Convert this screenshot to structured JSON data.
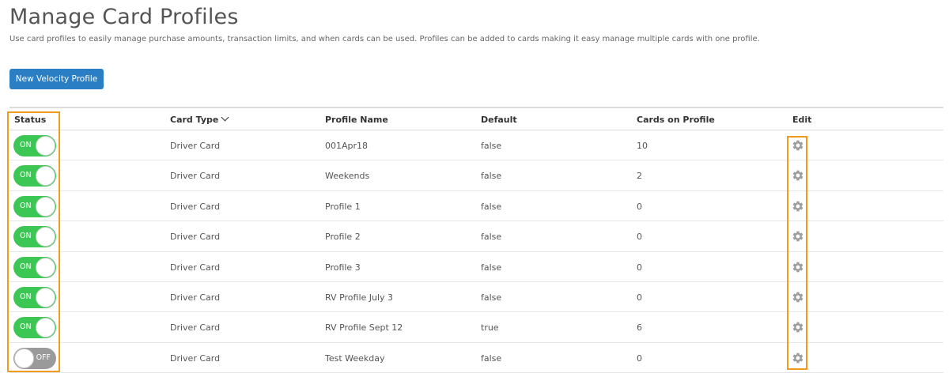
{
  "header": {
    "title": "Manage Card Profiles",
    "description": "Use card profiles to easily manage purchase amounts, transaction limits, and when cards can be used. Profiles can be added to cards making it easy manage multiple cards with one profile."
  },
  "actions": {
    "new_profile_label": "New Velocity Profile"
  },
  "table": {
    "columns": {
      "status": "Status",
      "card_type": "Card Type",
      "profile_name": "Profile Name",
      "default": "Default",
      "cards_on_profile": "Cards on Profile",
      "edit": "Edit"
    },
    "rows": [
      {
        "status": "ON",
        "card_type": "Driver Card",
        "profile_name": "001Apr18",
        "default": "false",
        "cards_on_profile": "10"
      },
      {
        "status": "ON",
        "card_type": "Driver Card",
        "profile_name": "Weekends",
        "default": "false",
        "cards_on_profile": "2"
      },
      {
        "status": "ON",
        "card_type": "Driver Card",
        "profile_name": "Profile 1",
        "default": "false",
        "cards_on_profile": "0"
      },
      {
        "status": "ON",
        "card_type": "Driver Card",
        "profile_name": "Profile 2",
        "default": "false",
        "cards_on_profile": "0"
      },
      {
        "status": "ON",
        "card_type": "Driver Card",
        "profile_name": "Profile 3",
        "default": "false",
        "cards_on_profile": "0"
      },
      {
        "status": "ON",
        "card_type": "Driver Card",
        "profile_name": "RV Profile July 3",
        "default": "false",
        "cards_on_profile": "0"
      },
      {
        "status": "ON",
        "card_type": "Driver Card",
        "profile_name": "RV Profile Sept 12",
        "default": "true",
        "cards_on_profile": "6"
      },
      {
        "status": "OFF",
        "card_type": "Driver Card",
        "profile_name": "Test Weekday",
        "default": "false",
        "cards_on_profile": "0"
      }
    ]
  },
  "icons": {
    "sort": "chevron-down-icon",
    "edit": "gear-icon"
  },
  "colors": {
    "primary_button": "#2a7ec4",
    "toggle_on": "#3cc754",
    "toggle_off": "#9a9a9a",
    "highlight": "#f39a1f",
    "gear": "#9e9e9e"
  }
}
